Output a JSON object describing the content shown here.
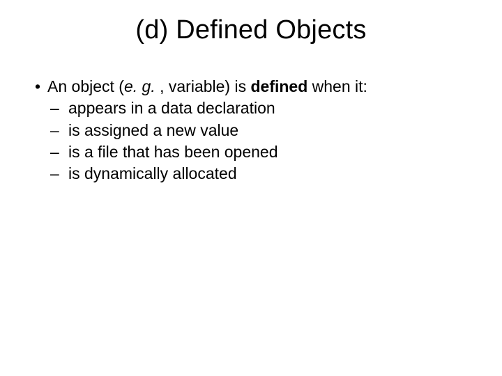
{
  "title": "(d) Defined Objects",
  "lead": {
    "pre": "An object (",
    "eg": "e. g. ",
    "mid": ", variable) is ",
    "defined": "defined",
    "post": " when it:"
  },
  "items": [
    "appears in a data declaration",
    "is assigned a new value",
    "is a file that has been opened",
    "is dynamically allocated"
  ]
}
